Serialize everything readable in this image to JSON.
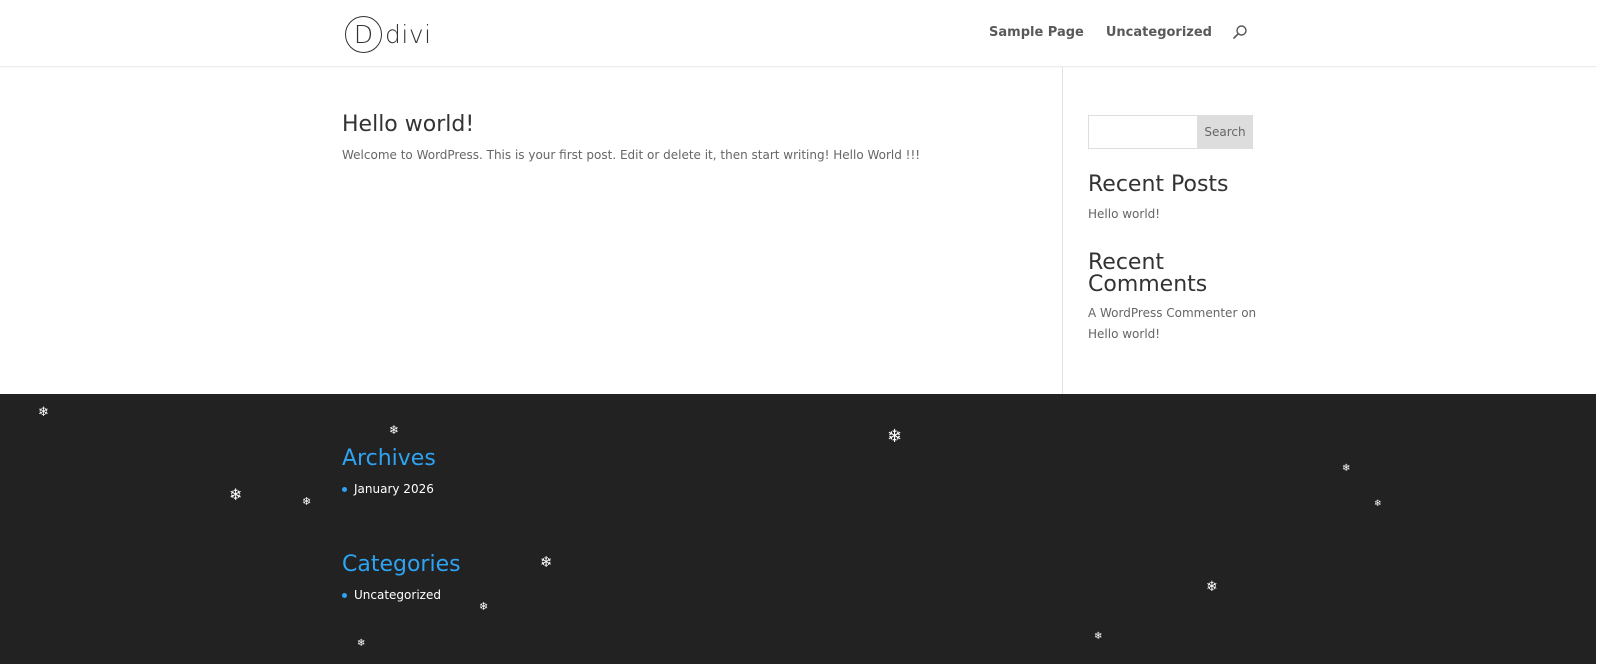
{
  "header": {
    "logo_letter": "D",
    "logo_text": "divi",
    "nav": [
      {
        "label": "Sample Page"
      },
      {
        "label": "Uncategorized"
      }
    ]
  },
  "post": {
    "title": "Hello world!",
    "excerpt": "Welcome to WordPress. This is your first post. Edit or delete it, then start writing! Hello World !!!"
  },
  "sidebar": {
    "search_value": "",
    "search_button": "Search",
    "recent_posts_title": "Recent Posts",
    "recent_posts": [
      "Hello world!"
    ],
    "recent_comments_title_line1": "Recent",
    "recent_comments_title_line2": "Comments",
    "comment_author": "A WordPress Commenter",
    "comment_on": "on",
    "comment_post": "Hello world!"
  },
  "footer": {
    "archives_title": "Archives",
    "archives": [
      "January 2026"
    ],
    "categories_title": "Categories",
    "categories": [
      "Uncategorized"
    ],
    "snowflake_glyph": "❄"
  },
  "colors": {
    "accent": "#2ea3f2",
    "footer_bg": "#222222",
    "heading": "#333333",
    "body_text": "#666666"
  }
}
